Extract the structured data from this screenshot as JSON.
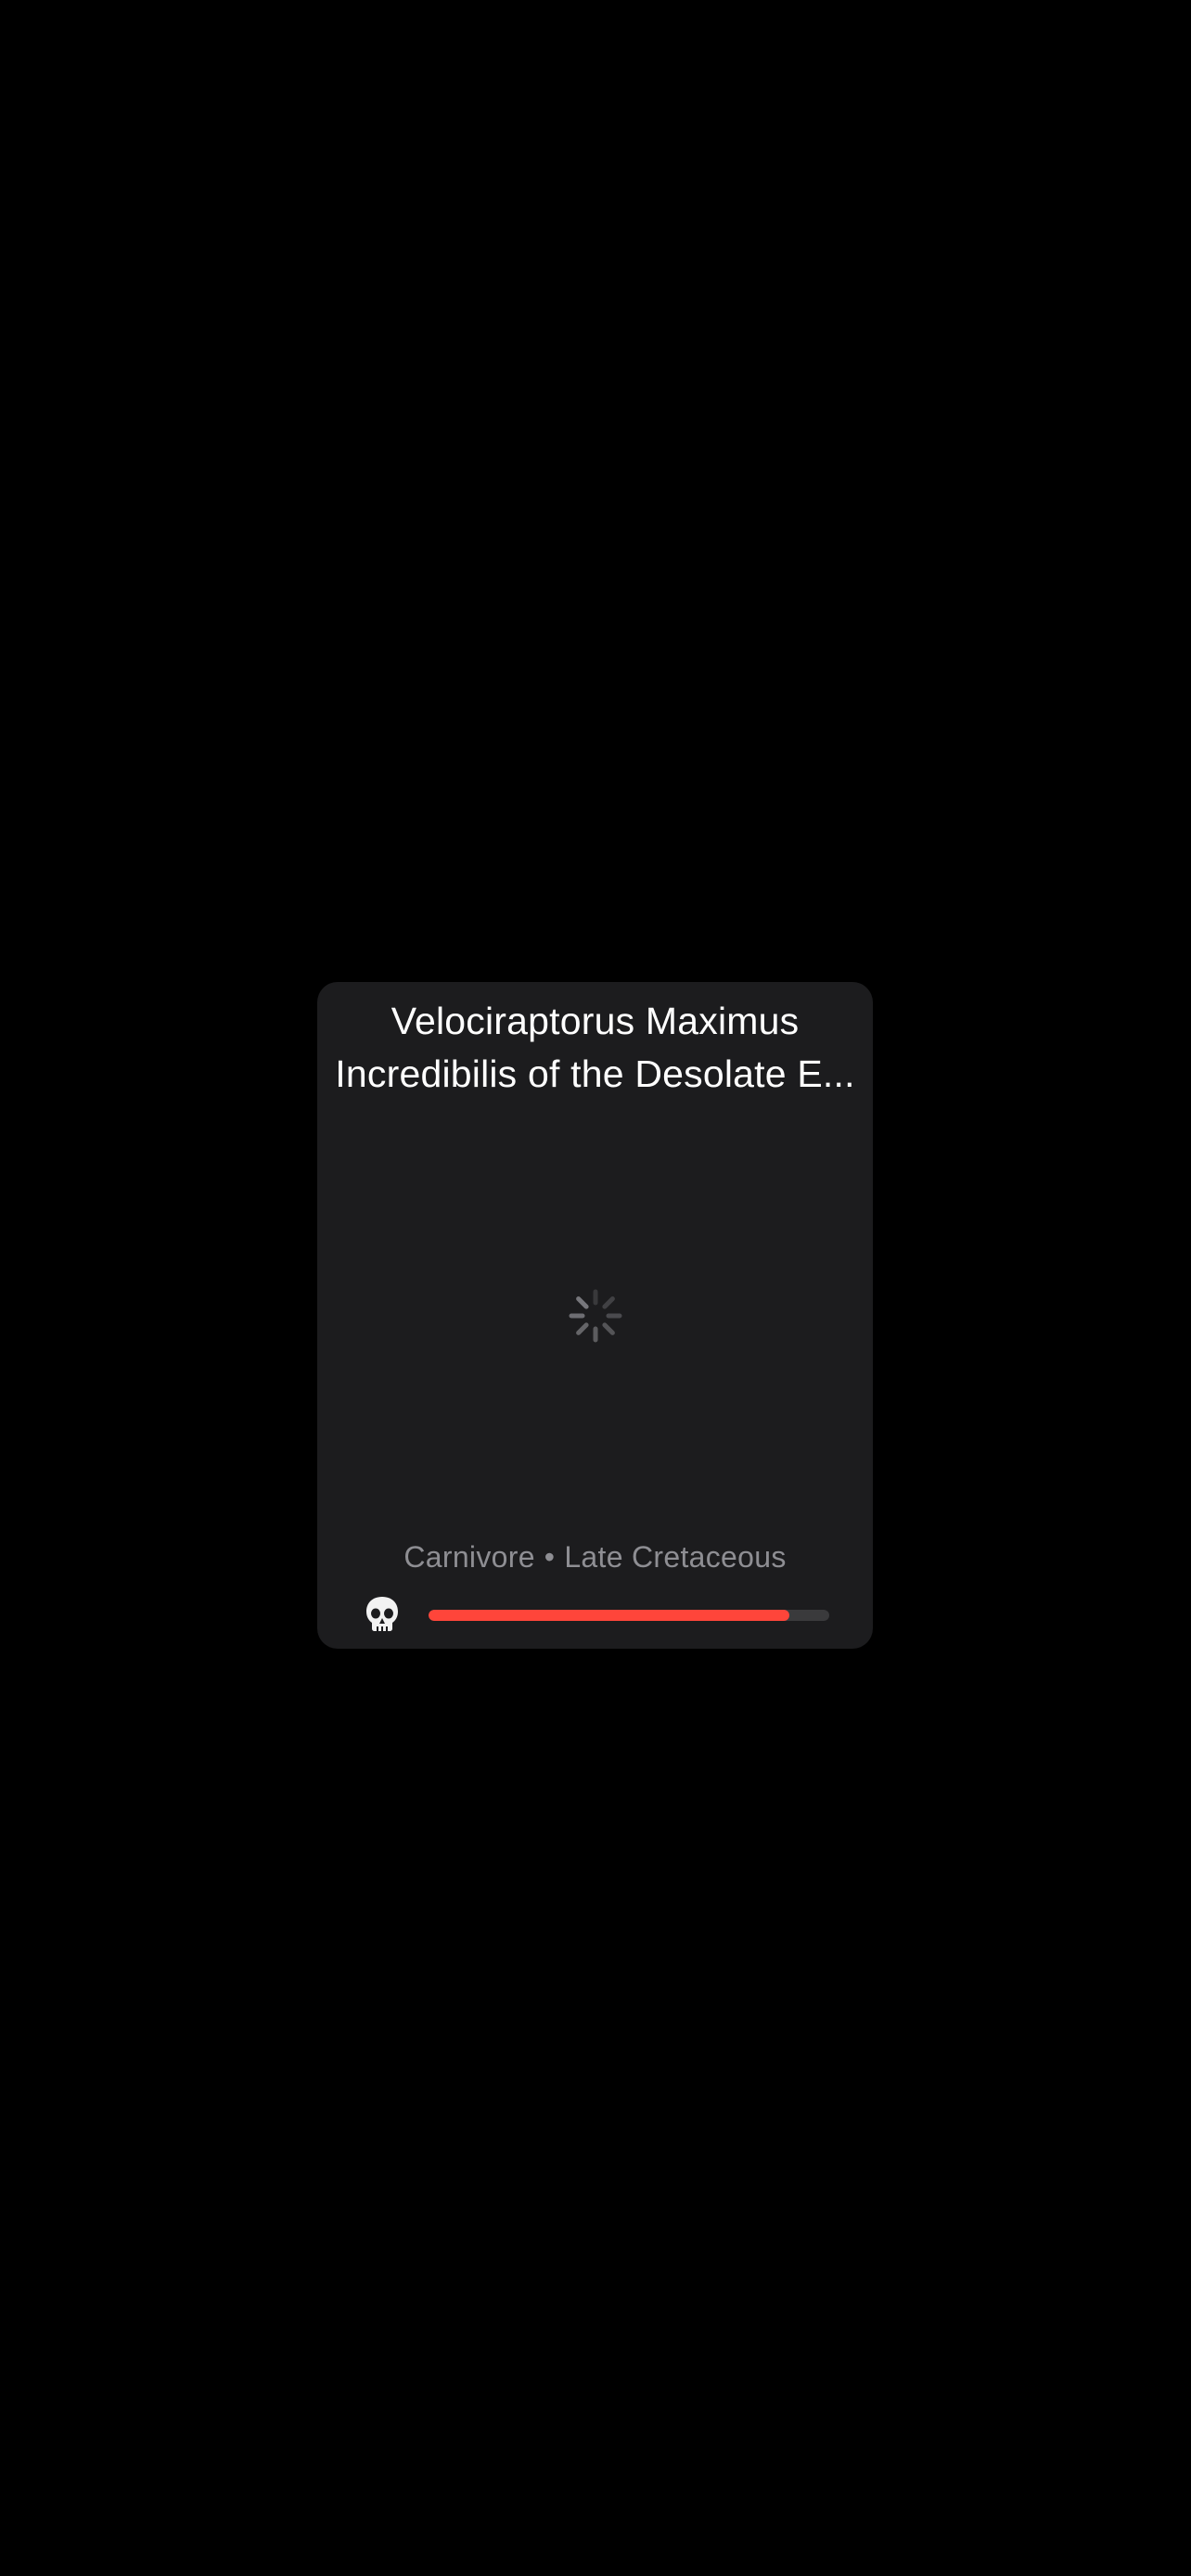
{
  "card": {
    "title_line1": "Velociraptorus Maximus",
    "title_line2": "Incredibilis of the Desolate E...",
    "diet": "Carnivore",
    "separator": "•",
    "period": "Late Cretaceous",
    "status_icon": "skull-icon",
    "health": {
      "value_fraction": 0.9,
      "fill_color": "#ff453a",
      "track_color": "#3a3a3c"
    },
    "loading_indicator": "activity-spinner-icon"
  }
}
